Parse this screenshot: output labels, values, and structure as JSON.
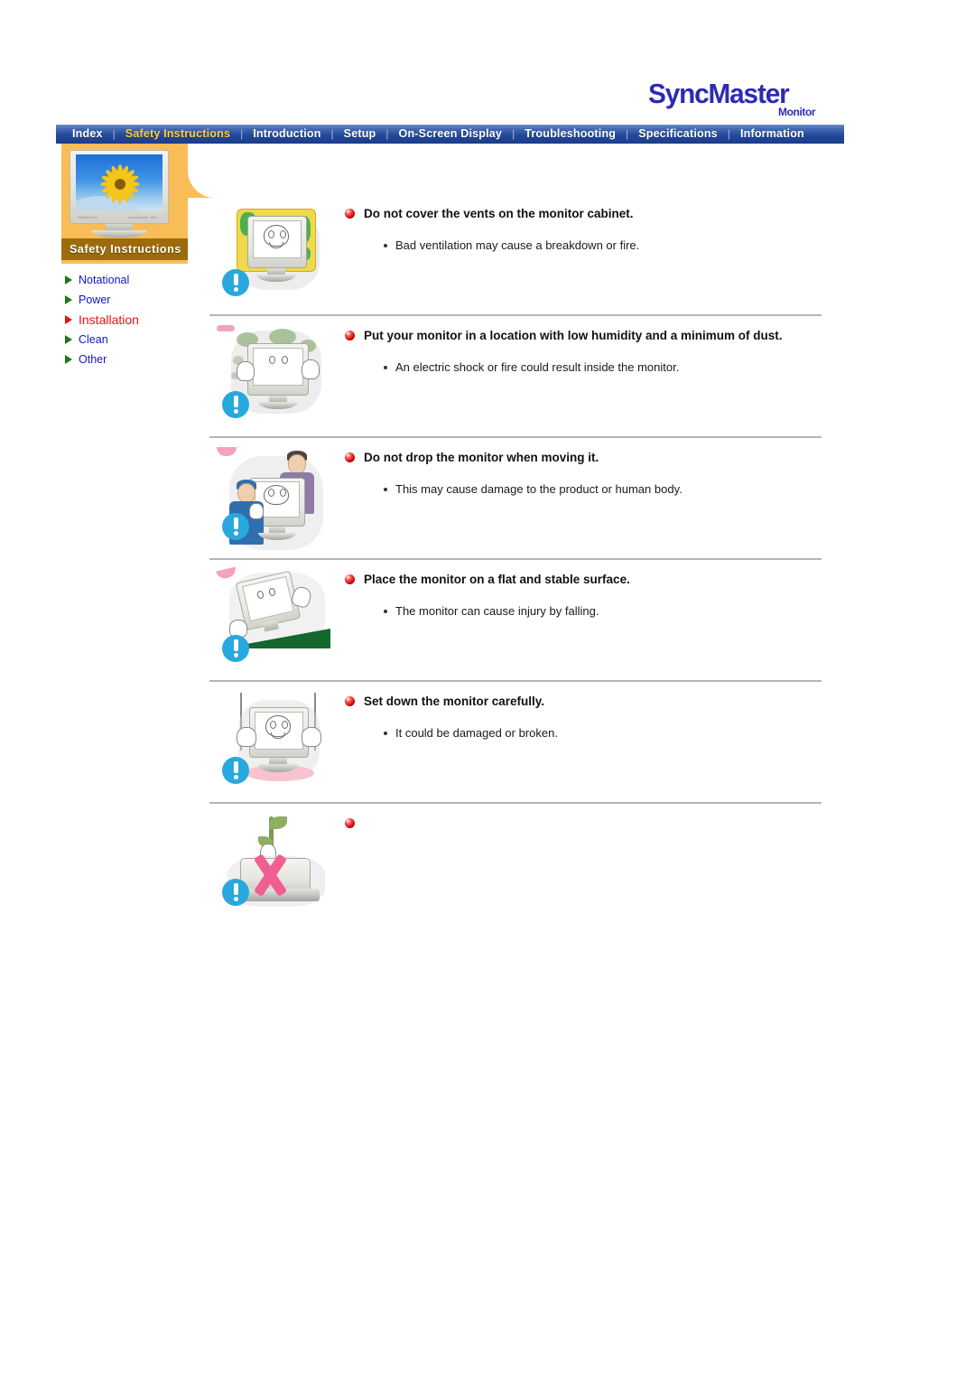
{
  "logo": {
    "brand_part1": "Sync",
    "brand_part2": "Master",
    "sub": "Monitor",
    "color": "#2b2bb5"
  },
  "nav": {
    "separator": "|",
    "active_index": 1,
    "items": [
      {
        "label": "Index"
      },
      {
        "label": "Safety Instructions"
      },
      {
        "label": "Introduction"
      },
      {
        "label": "Setup"
      },
      {
        "label": "On-Screen Display"
      },
      {
        "label": "Troubleshooting"
      },
      {
        "label": "Specifications"
      },
      {
        "label": "Information"
      }
    ],
    "bar_color": "#23499c",
    "active_color": "#ffcc33"
  },
  "sidebar": {
    "panel_title": "Safety Instructions",
    "panel_color": "#f8bd57",
    "title_band_color": "#9c6b0b",
    "thumbnail_caption_left": "SAMSUNG",
    "thumbnail_caption_right": "SyncMaster 997 …",
    "active_index": 2,
    "items": [
      {
        "label": "Notational",
        "active": false
      },
      {
        "label": "Power",
        "active": false
      },
      {
        "label": "Installation",
        "active": true
      },
      {
        "label": "Clean",
        "active": false
      },
      {
        "label": "Other",
        "active": false
      }
    ],
    "link_color": "#1414c8",
    "active_link_color": "#ee1111",
    "marker_color": "#1a7a1a",
    "active_marker_color": "#e81010"
  },
  "content": {
    "sections": [
      {
        "id": "vents",
        "heading": "Do not cover the vents on the monitor cabinet.",
        "bullets": [
          "Bad ventilation may cause a breakdown or fire."
        ],
        "illustration": "monitor-covered-with-cloth"
      },
      {
        "id": "humidity-dust",
        "heading": "Put your monitor in a location with low humidity and a minimum of dust.",
        "bullets": [
          "An electric shock or fire could result inside the monitor."
        ],
        "illustration": "monitor-in-dusty-room"
      },
      {
        "id": "do-not-drop",
        "heading": "Do not drop the monitor when moving it.",
        "bullets": [
          "This may cause damage to the product or human body."
        ],
        "illustration": "two-people-carrying-monitor"
      },
      {
        "id": "flat-stable-surface",
        "heading": "Place the monitor on a flat and stable surface.",
        "bullets": [
          "The monitor can cause injury by falling."
        ],
        "illustration": "monitor-on-sloped-surface"
      },
      {
        "id": "set-down-carefully",
        "heading": "Set down the monitor carefully.",
        "bullets": [
          "It could be damaged or broken."
        ],
        "illustration": "hands-setting-monitor-down"
      },
      {
        "id": "last-empty",
        "heading": "",
        "bullets": [],
        "illustration": "monitor-with-pink-x"
      }
    ],
    "warning_icon_color": "#29a8dd",
    "divider_color": "#b4b4b4",
    "bullet_ball_color": "#c00000"
  }
}
